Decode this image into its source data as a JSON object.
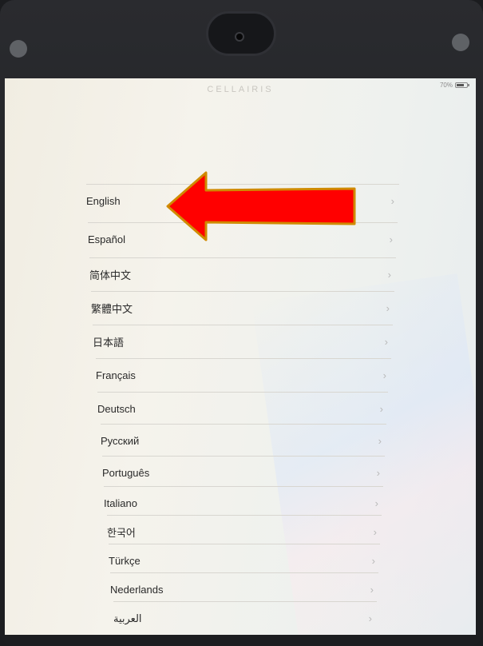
{
  "screen": {
    "watermark": "CELLAIRIS",
    "battery_percent": "70%"
  },
  "languages": [
    "English",
    "Español",
    "简体中文",
    "繁體中文",
    "日本語",
    "Français",
    "Deutsch",
    "Русский",
    "Português",
    "Italiano",
    "한국어",
    "Türkçe",
    "Nederlands",
    "العربية"
  ],
  "icons": {
    "chevron": "chevron-right-icon",
    "annotation": "red-arrow-icon"
  },
  "colors": {
    "arrow_fill": "#ff0000",
    "arrow_outline": "#d08a00"
  }
}
